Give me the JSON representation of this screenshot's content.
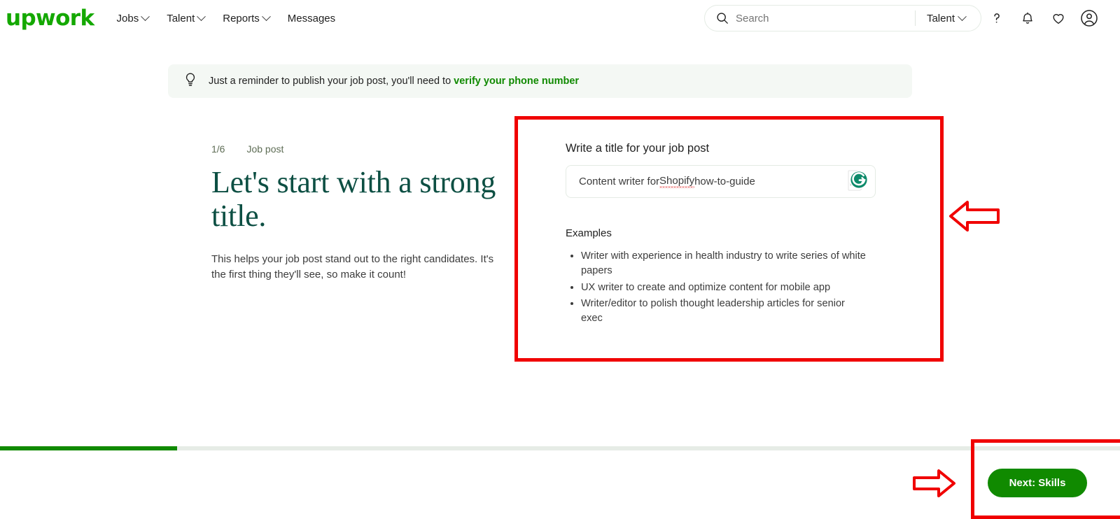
{
  "header": {
    "logo": "upwork",
    "nav": [
      {
        "label": "Jobs",
        "has_dropdown": true
      },
      {
        "label": "Talent",
        "has_dropdown": true
      },
      {
        "label": "Reports",
        "has_dropdown": true
      },
      {
        "label": "Messages",
        "has_dropdown": false
      }
    ],
    "search": {
      "placeholder": "Search",
      "value": "",
      "scope": "Talent"
    },
    "icons": [
      "help-icon",
      "notifications-icon",
      "saved-icon",
      "account-icon"
    ]
  },
  "banner": {
    "icon": "lightbulb-icon",
    "text": "Just a reminder to publish your job post, you'll need to ",
    "link": "verify your phone number"
  },
  "left": {
    "step": "1/6",
    "section": "Job post",
    "title": "Let's start with a strong title.",
    "description": "This helps your job post stand out to the right candidates. It's the first thing they'll see, so make it count!"
  },
  "right": {
    "field_label": "Write a title for your job post",
    "input_value": "Content writer for Shopify how-to-guide",
    "input_value_pre": "Content writer for ",
    "input_value_misspelled": "Shopify",
    "input_value_post": " how-to-guide",
    "input_placeholder": "Write a title for your job post",
    "examples_label": "Examples",
    "examples": [
      "Writer with experience in health industry to write series of white papers",
      "UX writer to create and optimize content for mobile app",
      "Writer/editor to polish thought leadership articles for senior exec"
    ],
    "grammarly_badge": "grammarly-icon"
  },
  "footer": {
    "progress_percent": 15.8,
    "next_label": "Next: Skills"
  },
  "colors": {
    "brand_green": "#14a800",
    "button_green": "#108a00",
    "heading_green": "#0d4f43",
    "annotation_red": "#f00000",
    "grammarly_teal": "#0d8a6a",
    "banner_bg": "#f4f8f4"
  },
  "annotations": [
    {
      "name": "highlight-box-title-panel",
      "shape": "rectangle"
    },
    {
      "name": "highlight-box-next-button",
      "shape": "rectangle"
    },
    {
      "name": "pointer-arrow-title-panel",
      "shape": "arrow-left"
    },
    {
      "name": "pointer-arrow-next-button",
      "shape": "arrow-right"
    }
  ]
}
